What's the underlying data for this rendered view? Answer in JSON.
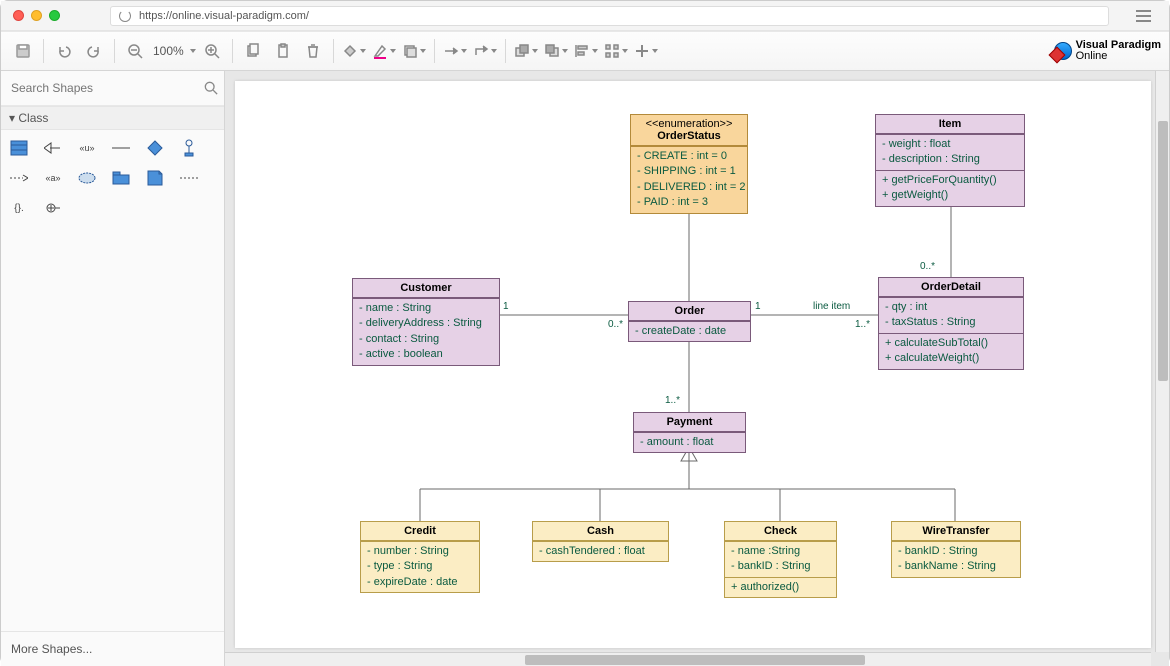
{
  "url": "https://online.visual-paradigm.com/",
  "zoom": "100%",
  "search_placeholder": "Search Shapes",
  "category": "Class",
  "more_shapes": "More Shapes...",
  "logo_top": "Visual Paradigm",
  "logo_bot": "Online",
  "classes": {
    "orderStatus": {
      "stereo": "<<enumeration>>",
      "name": "OrderStatus",
      "attrs": [
        "- CREATE : int  = 0",
        "- SHIPPING : int = 1",
        "- DELIVERED : int = 2",
        "- PAID : int = 3"
      ]
    },
    "item": {
      "name": "Item",
      "attrs": [
        "- weight : float",
        "- description : String"
      ],
      "ops": [
        "+ getPriceForQuantity()",
        "+ getWeight()"
      ]
    },
    "customer": {
      "name": "Customer",
      "attrs": [
        "- name : String",
        "- deliveryAddress : String",
        "- contact : String",
        "- active : boolean"
      ]
    },
    "order": {
      "name": "Order",
      "attrs": [
        "- createDate : date"
      ]
    },
    "orderDetail": {
      "name": "OrderDetail",
      "attrs": [
        "- qty : int",
        "- taxStatus : String"
      ],
      "ops": [
        "+ calculateSubTotal()",
        "+ calculateWeight()"
      ]
    },
    "payment": {
      "name": "Payment",
      "attrs": [
        "- amount : float"
      ]
    },
    "credit": {
      "name": "Credit",
      "attrs": [
        "- number : String",
        "- type : String",
        "- expireDate : date"
      ]
    },
    "cash": {
      "name": "Cash",
      "attrs": [
        "- cashTendered : float"
      ]
    },
    "check": {
      "name": "Check",
      "attrs": [
        "- name :String",
        "- bankID : String"
      ],
      "ops": [
        "+ authorized()"
      ]
    },
    "wire": {
      "name": "WireTransfer",
      "attrs": [
        "- bankID : String",
        "- bankName : String"
      ]
    }
  },
  "labels": {
    "m1": "1",
    "m0s": "0..*",
    "m1s": "1..*",
    "lineitem": "line item"
  }
}
